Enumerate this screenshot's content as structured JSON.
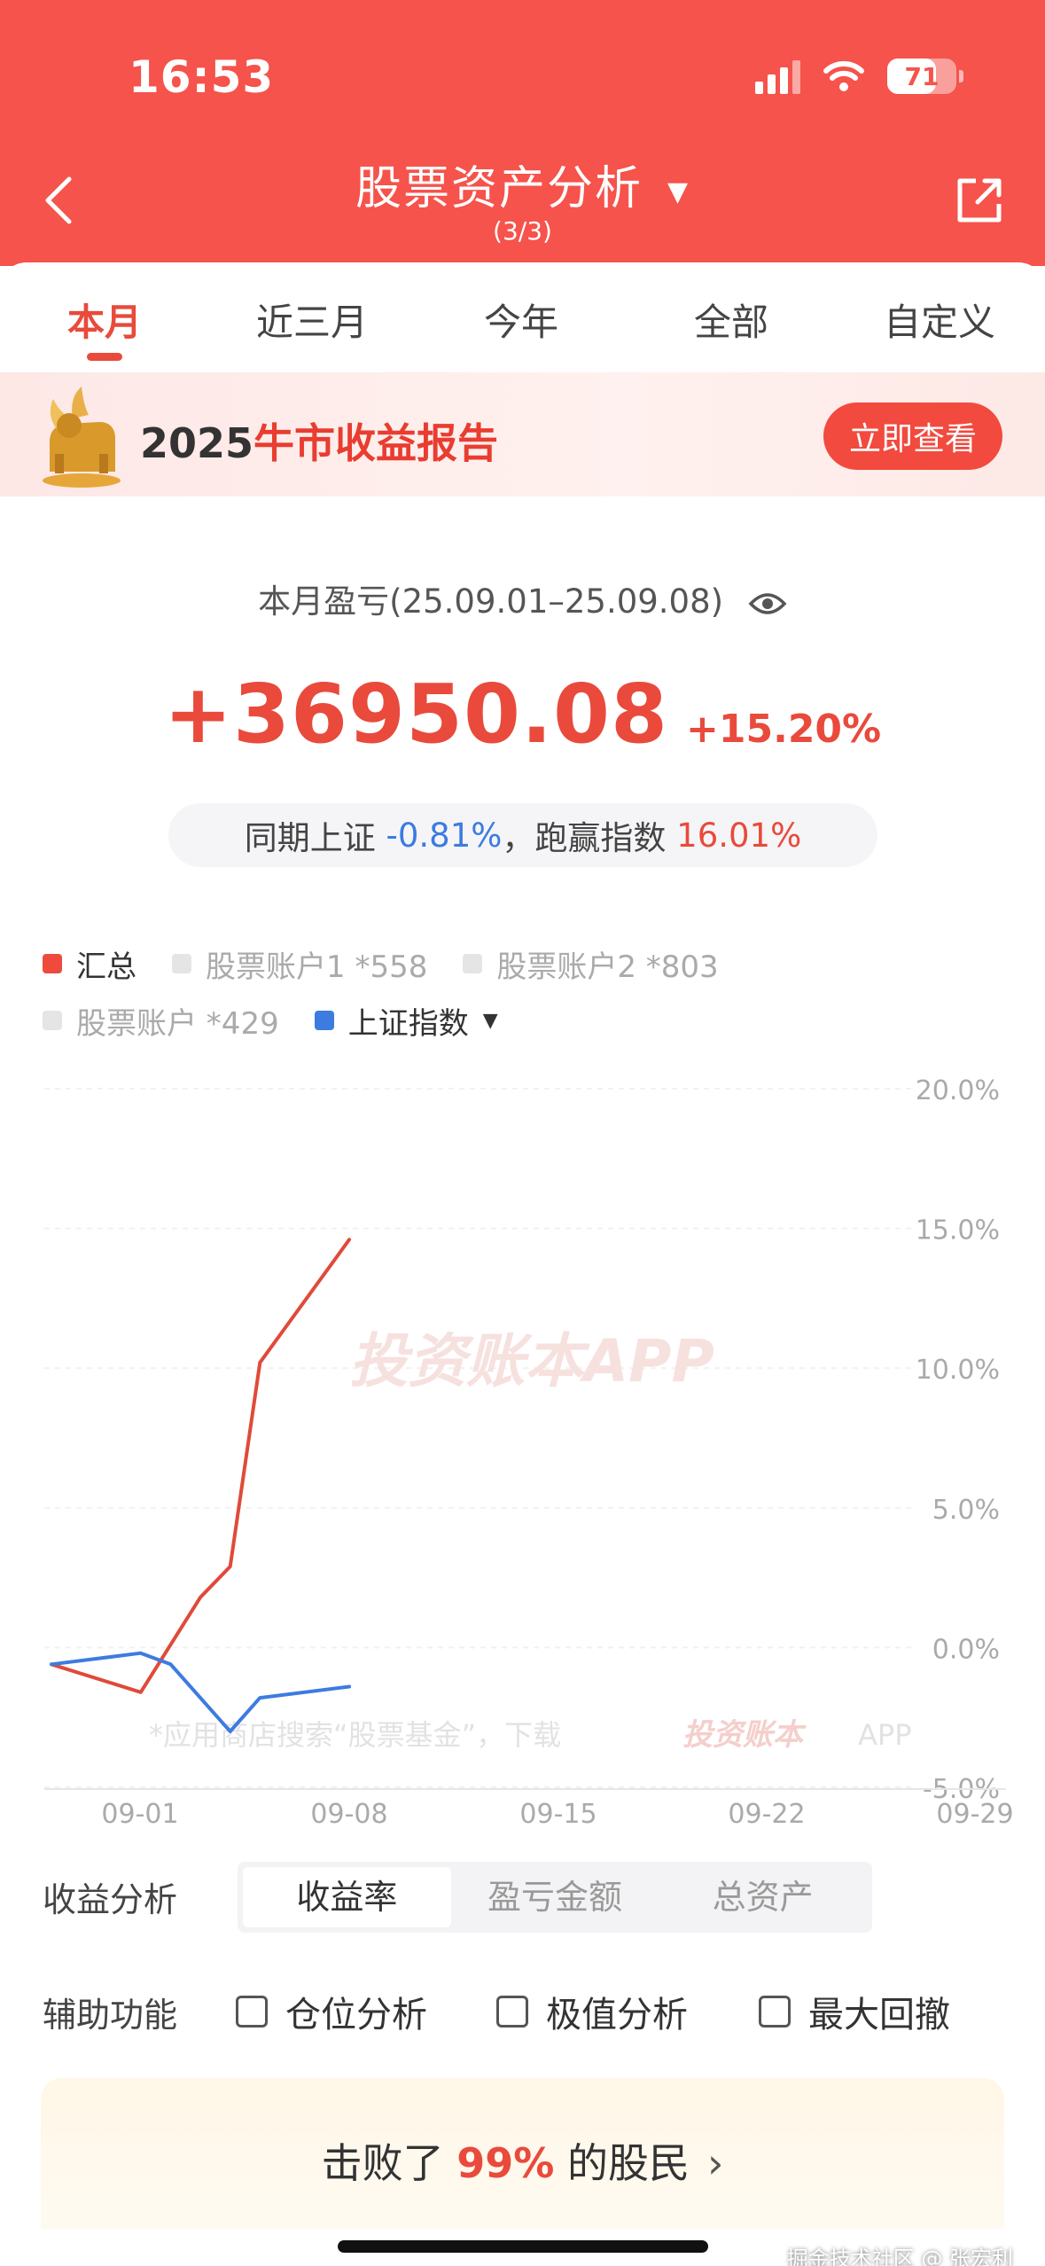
{
  "status_bar": {
    "time": "16:53",
    "battery": "71",
    "battery_level": 0.71
  },
  "nav": {
    "title": "股票资产分析",
    "subtitle": "(3/3)"
  },
  "tabs": [
    {
      "label": "本月",
      "active": true
    },
    {
      "label": "近三月",
      "active": false
    },
    {
      "label": "今年",
      "active": false
    },
    {
      "label": "全部",
      "active": false
    },
    {
      "label": "自定义",
      "active": false
    }
  ],
  "banner": {
    "year": "2025",
    "title": "牛市收益报告",
    "button": "立即查看"
  },
  "summary": {
    "period_label": "本月盈亏(25.09.01–25.09.08)",
    "amount": "+36950.08",
    "percent": "+15.20%",
    "compare_prefix": "同期上证",
    "compare_index": "-0.81%",
    "compare_mid": "，跑赢指数",
    "compare_beat": "16.01%"
  },
  "legend": [
    {
      "label": "汇总",
      "color": "#ee4b3c",
      "on": true
    },
    {
      "label": "股票账户1 *558",
      "color": "#e5e5e5",
      "on": false
    },
    {
      "label": "股票账户2 *803",
      "color": "#e5e5e5",
      "on": false
    },
    {
      "label": "股票账户 *429",
      "color": "#e5e5e5",
      "on": false
    },
    {
      "label": "上证指数",
      "color": "#3d7be0",
      "on": true,
      "dropdown": true
    }
  ],
  "chart_data": {
    "type": "line",
    "x_ticks": [
      "09-01",
      "09-08",
      "09-15",
      "09-22",
      "09-29"
    ],
    "y_ticks": [
      "20.0%",
      "15.0%",
      "10.0%",
      "5.0%",
      "0.0%",
      "-5.0%"
    ],
    "ylim": [
      -5,
      20
    ],
    "x_domain": [
      "2025-08-29",
      "2025-09-29"
    ],
    "series": [
      {
        "name": "汇总",
        "color": "#e04a3a",
        "points": [
          [
            "2025-08-29",
            -0.6
          ],
          [
            "2025-09-01",
            -1.6
          ],
          [
            "2025-09-03",
            1.8
          ],
          [
            "2025-09-04",
            2.9
          ],
          [
            "2025-09-05",
            10.2
          ],
          [
            "2025-09-08",
            14.6
          ]
        ]
      },
      {
        "name": "上证指数",
        "color": "#3d7be0",
        "points": [
          [
            "2025-08-29",
            -0.6
          ],
          [
            "2025-09-01",
            -0.2
          ],
          [
            "2025-09-02",
            -0.6
          ],
          [
            "2025-09-04",
            -3.0
          ],
          [
            "2025-09-05",
            -1.8
          ],
          [
            "2025-09-08",
            -1.4
          ]
        ]
      }
    ],
    "chart_watermark": "投资账本APP",
    "footer_note": "*应用商店搜索“股票基金”，下载",
    "footer_brand": "投资账本",
    "footer_app": "APP"
  },
  "analysis": {
    "label": "收益分析",
    "options": [
      "收益率",
      "盈亏金额",
      "总资产"
    ],
    "active": 0
  },
  "aux": {
    "label": "辅助功能",
    "options": [
      "仓位分析",
      "极值分析",
      "最大回撤"
    ]
  },
  "beat": {
    "prefix": "击败了",
    "value": "99%",
    "suffix": "的股民"
  },
  "watermark": "掘金技术社区 @ 张宏利"
}
